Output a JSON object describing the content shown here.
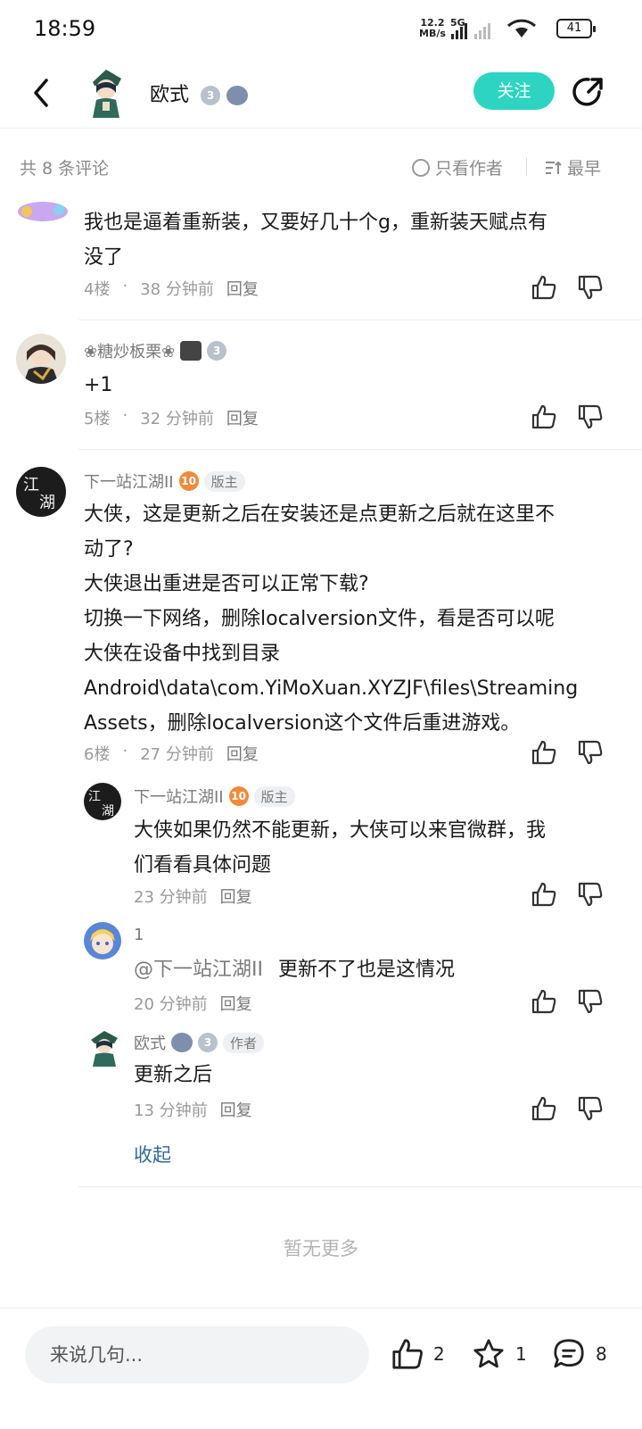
{
  "status_bar": {
    "time": "18:59",
    "net_speed": "12.2",
    "net_unit": "MB/s",
    "network": "5G",
    "battery": "41"
  },
  "header": {
    "title": "欧式",
    "follow_label": "关注"
  },
  "filters": {
    "count_label": "共 8 条评论",
    "only_author_label": "只看作者",
    "sort_label": "最早"
  },
  "comments": [
    {
      "username": "",
      "text_lines": [
        "我也是逼着重新装，又要好几十个g，重新装天赋点有",
        "没了"
      ],
      "floor": "4楼",
      "time": "38 分钟前",
      "reply_label": "回复"
    },
    {
      "username": "❀糖炒板栗❀",
      "level": "3",
      "text_lines": [
        "+1"
      ],
      "floor": "5楼",
      "time": "32 分钟前",
      "reply_label": "回复"
    },
    {
      "username": "下一站江湖II",
      "level": "10",
      "tag": "版主",
      "text_lines": [
        "大侠，这是更新之后在安装还是点更新之后就在这里不",
        "动了?",
        "大侠退出重进是否可以正常下载?",
        "切换一下网络，删除localversion文件，看是否可以呢",
        "大侠在设备中找到目录",
        "Android\\data\\com.YiMoXuan.XYZJF\\files\\Streaming",
        "Assets，删除localversion这个文件后重进游戏。"
      ],
      "floor": "6楼",
      "time": "27 分钟前",
      "reply_label": "回复"
    }
  ],
  "replies": [
    {
      "username": "下一站江湖II",
      "level": "10",
      "tag": "版主",
      "text_lines": [
        "大侠如果仍然不能更新，大侠可以来官微群，我",
        "们看看具体问题"
      ],
      "time": "23 分钟前",
      "reply_label": "回复"
    },
    {
      "username": "1",
      "mention": "@下一站江湖II",
      "text_lines": [
        "更新不了也是这情况"
      ],
      "time": "20 分钟前",
      "reply_label": "回复"
    },
    {
      "username": "欧式",
      "level": "3",
      "tag": "作者",
      "text_lines": [
        "更新之后"
      ],
      "time": "13 分钟前",
      "reply_label": "回复"
    }
  ],
  "collapse_label": "收起",
  "no_more_label": "暂无更多",
  "bottom_bar": {
    "input_placeholder": "来说几句...",
    "like_count": "2",
    "star_count": "1",
    "comment_count": "8"
  },
  "colors": {
    "follow": "#2dd4c2",
    "link": "#2f6a9a",
    "level_orange": "#f08a3b"
  }
}
